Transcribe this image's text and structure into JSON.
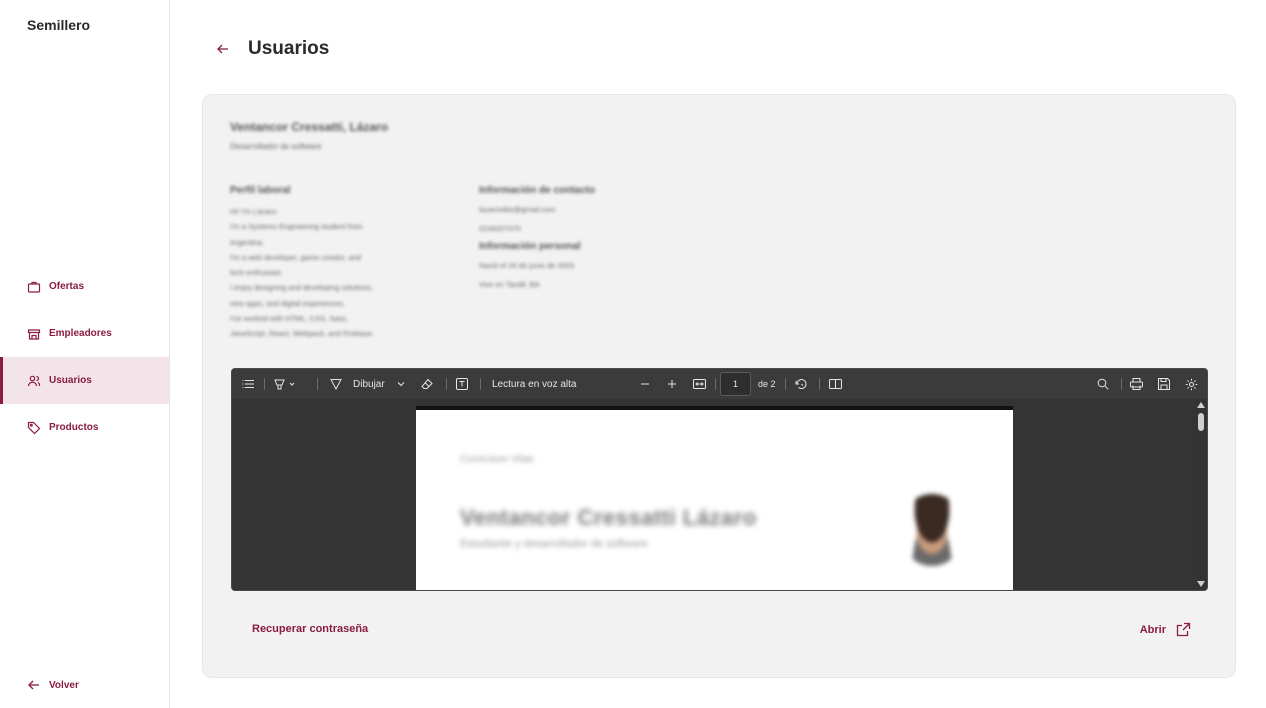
{
  "app": {
    "brand": "Semillero",
    "accent": "#8a1c3f"
  },
  "sidebar": {
    "items": [
      {
        "label": "Ofertas",
        "icon": "briefcase-icon",
        "active": false
      },
      {
        "label": "Empleadores",
        "icon": "store-icon",
        "active": false
      },
      {
        "label": "Usuarios",
        "icon": "users-icon",
        "active": true
      },
      {
        "label": "Productos",
        "icon": "tag-icon",
        "active": false
      }
    ],
    "back_label": "Volver"
  },
  "header": {
    "title": "Usuarios"
  },
  "user": {
    "name": "Ventancor Cressatti, Lázaro",
    "role": "Desarrollador de software",
    "work_profile_title": "Perfil laboral",
    "bio": "Hi! I'm Lázaro.\nI'm a Systems Engineering student from\nArgentina.\nI'm a web developer, game creator, and\ntech enthusiast.\nI enjoy designing and developing solutions,\nnew apps, and digital experiences.\nI've worked with HTML, CSS, Sass,\nJavaScript, React, Webpack, and Firebase.",
    "contact_title": "Información de contacto",
    "email": "lazarovtbe@gmail.com",
    "phone": "0234207070",
    "personal_title": "Información personal",
    "birth": "Nació el 26 de junio de 2003",
    "location": "Vive en Tandil, BA"
  },
  "viewer": {
    "draw_label": "Dibujar",
    "read_aloud_label": "Lectura en voz alta",
    "page_current": "1",
    "page_total": "de 2",
    "doc_small": "Curriculum Vitae",
    "doc_name": "Ventancor Cressatti Lázaro",
    "doc_subtitle": "Estudiante y desarrollador de software"
  },
  "actions": {
    "reset_password": "Recuperar contraseña",
    "open": "Abrir"
  }
}
